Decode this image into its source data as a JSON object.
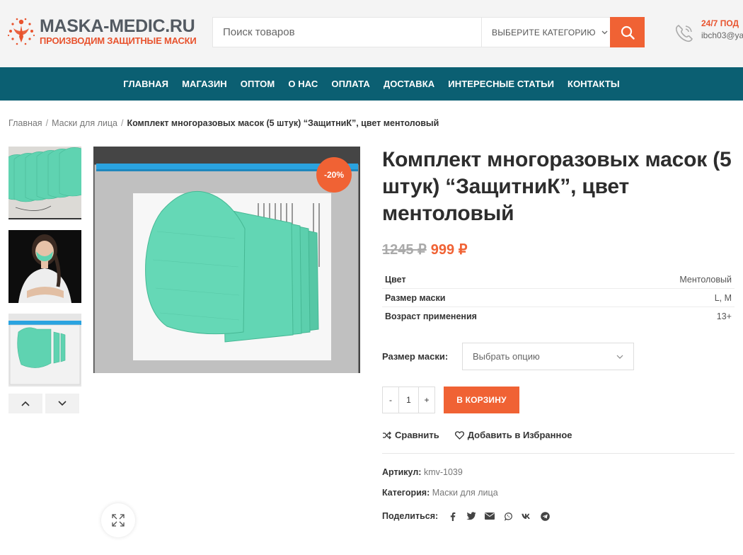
{
  "brand": {
    "name": "MASKA-MEDIC.RU",
    "tagline": "ПРОИЗВОДИМ ЗАЩИТНЫЕ МАСКИ"
  },
  "search": {
    "placeholder": "Поиск товаров",
    "category": "ВЫБЕРИТЕ КАТЕГОРИЮ"
  },
  "support": {
    "title": "24/7 ПОД",
    "email": "ibch03@ya"
  },
  "nav": [
    "ГЛАВНАЯ",
    "МАГАЗИН",
    "ОПТОМ",
    "О НАС",
    "ОПЛАТА",
    "ДОСТАВКА",
    "ИНТЕРЕСНЫЕ СТАТЬИ",
    "КОНТАКТЫ"
  ],
  "breadcrumbs": {
    "home": "Главная",
    "category": "Маски для лица",
    "current": "Комплект многоразовых масок (5 штук) “ЗащитниК”, цвет ментоловый"
  },
  "product": {
    "title": "Комплект многоразовых масок (5 штук) “ЗащитниК”, цвет ментоловый",
    "old_price": "1245 ₽",
    "new_price": "999 ₽",
    "discount": "-20%",
    "attributes": [
      {
        "key": "Цвет",
        "value": "Ментоловый"
      },
      {
        "key": "Размер маски",
        "value": "L, M"
      },
      {
        "key": "Возраст применения",
        "value": "13+"
      }
    ],
    "option_label": "Размер маски",
    "option_placeholder": "Выбрать опцию",
    "qty": {
      "minus": "-",
      "value": "1",
      "plus": "+"
    },
    "add_to_cart": "В КОРЗИНУ",
    "compare": "Сравнить",
    "wishlist": "Добавить в Избранное",
    "sku_label": "Артикул:",
    "sku": "kmv-1039",
    "category_label": "Категория:",
    "category": "Маски для лица",
    "share_label": "Поделиться:",
    "share_icons": [
      "facebook-icon",
      "twitter-icon",
      "email-icon",
      "whatsapp-icon",
      "vk-icon",
      "telegram-icon"
    ]
  },
  "colors": {
    "accent": "#f06234",
    "nav_bg": "#0b5f72",
    "mint": "#5fd3b1"
  }
}
